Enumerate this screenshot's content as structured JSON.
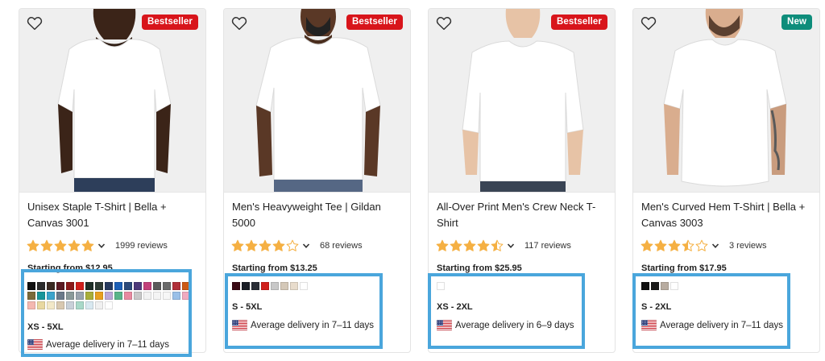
{
  "colors": {
    "badge_red": "#d8151b",
    "badge_teal": "#0e8d7b",
    "star": "#f5b043",
    "star_empty": "#f5b043",
    "highlight_border": "#4aa6dc"
  },
  "products": [
    {
      "badge": "Bestseller",
      "title": "Unisex Staple T-Shirt | Bella + Canvas 3001",
      "rating": 5,
      "reviews": "1999 reviews",
      "price": "Starting from $12.95",
      "sizes": "XS - 5XL",
      "delivery": "Average delivery in 7–11 days",
      "swatches": [
        "#111111",
        "#2b2b2b",
        "#3a2a22",
        "#5b1a22",
        "#8b1a1a",
        "#d0201c",
        "#1f2f28",
        "#2e3b34",
        "#263a5e",
        "#1c5fb6",
        "#2c4a7a",
        "#4d3a7a",
        "#c2407a",
        "#5a5a5a",
        "#6a6a6a",
        "#b0303a",
        "#cc5a16",
        "#7a6a3a",
        "#18959a",
        "#3ba4cc",
        "#6a7a8a",
        "#8a9a9a",
        "#99a4ae",
        "#a8ae3a",
        "#e8a020",
        "#bba8d8",
        "#5ab48a",
        "#e88aa0",
        "#c8c8c8",
        "#f2f2f2",
        "#f4f4f4",
        "#f6f6f6",
        "#9ac0e8",
        "#f0aac0",
        "#f4b8b0",
        "#e8d8a0",
        "#f2e8c8",
        "#d8c8b0",
        "#c8d0d8",
        "#a8d8c8",
        "#d8e8f0",
        "#f0f0f0",
        "#ffffff"
      ]
    },
    {
      "badge": "Bestseller",
      "title": "Men's Heavyweight Tee | Gildan 5000",
      "rating": 4,
      "reviews": "68 reviews",
      "price": "Starting from $13.25",
      "sizes": "S - 5XL",
      "delivery": "Average delivery in 7–11 days",
      "swatches": [
        "#3a0a14",
        "#1a1e26",
        "#2a2e36",
        "#d0201c",
        "#c8c8c8",
        "#d4c8b8",
        "#e8dccc",
        "#ffffff"
      ]
    },
    {
      "badge": "Bestseller",
      "title": "All-Over Print Men's Crew Neck T-Shirt",
      "rating": 4.5,
      "reviews": "117 reviews",
      "price": "Starting from $25.95",
      "sizes": "XS - 2XL",
      "delivery": "Average delivery in 6–9 days",
      "swatches": [
        "#ffffff"
      ]
    },
    {
      "badge": "New",
      "title": "Men's Curved Hem T-Shirt | Bella + Canvas 3003",
      "rating": 3.5,
      "reviews": "3 reviews",
      "price": "Starting from $17.95",
      "sizes": "S - 2XL",
      "delivery": "Average delivery in 7–11 days",
      "swatches": [
        "#111111",
        "#1a1a1a",
        "#b8aca0",
        "#ffffff"
      ]
    }
  ]
}
